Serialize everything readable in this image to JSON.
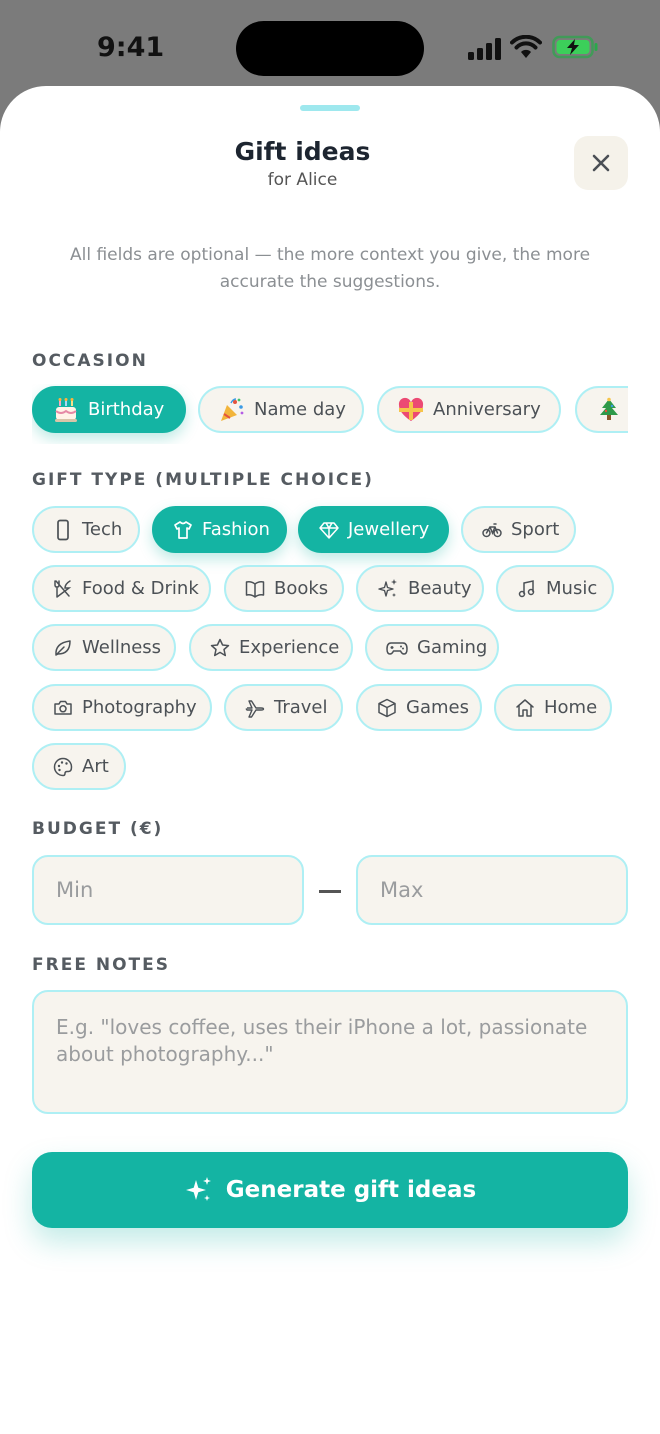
{
  "status": {
    "time": "9:41"
  },
  "header": {
    "title": "Gift ideas",
    "subtitle": "for Alice"
  },
  "hint": "All fields are optional — the more context you give, the more accurate the suggestions.",
  "occasion": {
    "label": "OCCASION",
    "selected": "Birthday",
    "options": [
      "Birthday",
      "Name day",
      "Anniversary"
    ]
  },
  "gift_type": {
    "label": "GIFT TYPE (MULTIPLE CHOICE)",
    "selected": [
      "Fashion",
      "Jewellery"
    ],
    "options": [
      "Tech",
      "Fashion",
      "Jewellery",
      "Sport",
      "Food & Drink",
      "Books",
      "Beauty",
      "Music",
      "Wellness",
      "Experience",
      "Gaming",
      "Photography",
      "Travel",
      "Games",
      "Home",
      "Art"
    ]
  },
  "budget": {
    "label": "BUDGET (€)",
    "min_placeholder": "Min",
    "max_placeholder": "Max"
  },
  "notes": {
    "label": "FREE NOTES",
    "placeholder": "E.g. \"loves coffee, uses their iPhone a lot, passionate about photography...\""
  },
  "cta": {
    "label": "Generate gift ideas"
  },
  "colors": {
    "accent": "#14b4a3",
    "chip_border": "#aeeff4",
    "chip_bg": "#f7f4ee"
  }
}
